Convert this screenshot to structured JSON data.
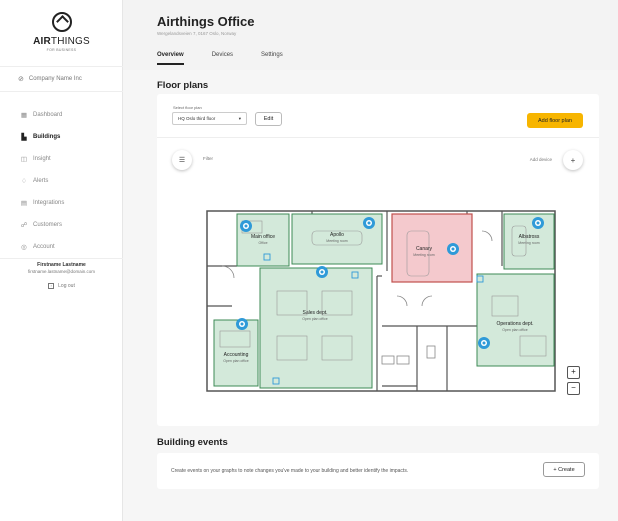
{
  "sidebar": {
    "brand_bold": "AIR",
    "brand_thin": "THINGS",
    "brand_sub": "FOR BUSINESS",
    "company": "Company Name Inc",
    "items": [
      {
        "label": "Dashboard",
        "icon": "grid-icon"
      },
      {
        "label": "Buildings",
        "icon": "building-icon"
      },
      {
        "label": "Insight",
        "icon": "chart-icon"
      },
      {
        "label": "Alerts",
        "icon": "bell-icon"
      },
      {
        "label": "Integrations",
        "icon": "integrations-icon"
      },
      {
        "label": "Customers",
        "icon": "customers-icon"
      },
      {
        "label": "Account",
        "icon": "account-icon"
      }
    ],
    "active_item": "Buildings",
    "user_name": "Firstname Lastname",
    "user_email": "firstname.lastname@domain.com",
    "logout": "Log out"
  },
  "header": {
    "title": "Airthings Office",
    "address": "Wergelandsveien 7, 0167 Oslo, Norway",
    "tabs": [
      "Overview",
      "Devices",
      "Settings"
    ],
    "active_tab": "Overview"
  },
  "floor_plans": {
    "title": "Floor plans",
    "select_label": "Select floor plan",
    "select_value": "HQ Oslo third floor",
    "edit_label": "Edit",
    "add_label": "Add floor plan",
    "filter_label": "Filter",
    "add_device_label": "Add device",
    "zoom_in": "+",
    "zoom_out": "−",
    "rooms": [
      {
        "name": "Main office",
        "type": "Office",
        "status": "green"
      },
      {
        "name": "Apollo",
        "type": "Meeting room",
        "status": "green"
      },
      {
        "name": "Canary",
        "type": "Meeting room",
        "status": "red"
      },
      {
        "name": "Albatross",
        "type": "Meeting room",
        "status": "green"
      },
      {
        "name": "Sales dept.",
        "type": "Open plan office",
        "status": "green"
      },
      {
        "name": "Operations dept.",
        "type": "Open plan office",
        "status": "green"
      },
      {
        "name": "Accounting",
        "type": "Open plan office",
        "status": "green"
      }
    ]
  },
  "building_events": {
    "title": "Building events",
    "text": "Create events on your graphs to note changes you've made to your building and better identify the impacts.",
    "create_label": "+ Create"
  },
  "colors": {
    "accent": "#f7b500",
    "room_green": "#d3e9da",
    "room_red": "#f4c9cd",
    "sensor_blue": "#2f9ad8"
  }
}
